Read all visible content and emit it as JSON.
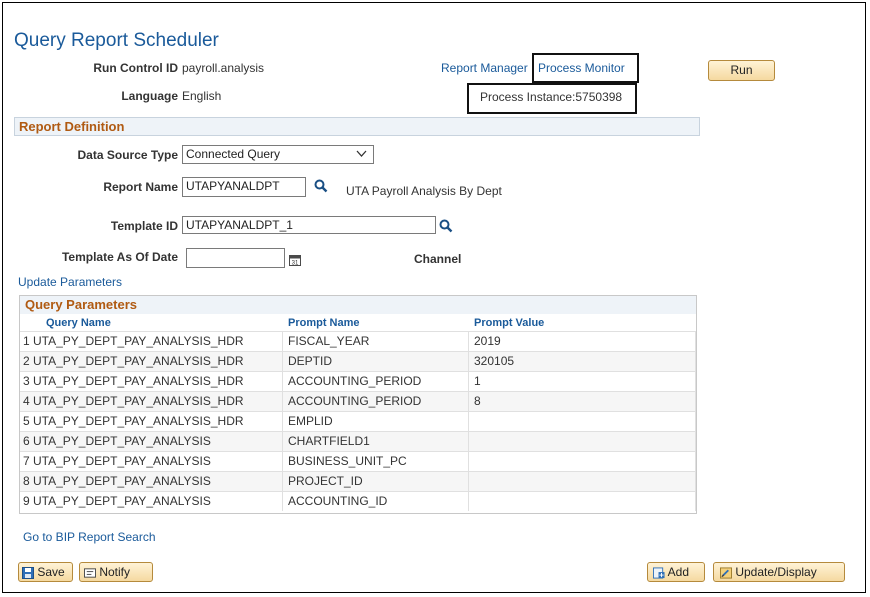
{
  "page": {
    "title": "Query Report Scheduler",
    "run_control_label": "Run Control ID",
    "run_control_value": "payroll.analysis",
    "language_label": "Language",
    "language_value": "English",
    "report_manager_link": "Report Manager",
    "process_monitor_link": "Process Monitor",
    "process_instance": "Process Instance:5750398",
    "run_button": "Run"
  },
  "report_definition": {
    "header": "Report Definition",
    "data_source_label": "Data Source Type",
    "data_source_value": "Connected Query",
    "report_name_label": "Report Name",
    "report_name_value": "UTAPYANALDPT",
    "report_description": "UTA Payroll Analysis By Dept",
    "template_id_label": "Template ID",
    "template_id_value": "UTAPYANALDPT_1",
    "template_date_label": "Template As Of Date",
    "template_date_value": "",
    "channel_label": "Channel",
    "update_parameters_link": "Update Parameters"
  },
  "query_parameters": {
    "header": "Query Parameters",
    "columns": [
      "Query Name",
      "Prompt Name",
      "Prompt Value"
    ],
    "rows": [
      {
        "num": "1",
        "query": "UTA_PY_DEPT_PAY_ANALYSIS_HDR",
        "prompt": "FISCAL_YEAR",
        "value": "2019"
      },
      {
        "num": "2",
        "query": "UTA_PY_DEPT_PAY_ANALYSIS_HDR",
        "prompt": "DEPTID",
        "value": "320105"
      },
      {
        "num": "3",
        "query": "UTA_PY_DEPT_PAY_ANALYSIS_HDR",
        "prompt": "ACCOUNTING_PERIOD",
        "value": "1"
      },
      {
        "num": "4",
        "query": "UTA_PY_DEPT_PAY_ANALYSIS_HDR",
        "prompt": "ACCOUNTING_PERIOD",
        "value": "8"
      },
      {
        "num": "5",
        "query": "UTA_PY_DEPT_PAY_ANALYSIS_HDR",
        "prompt": "EMPLID",
        "value": ""
      },
      {
        "num": "6",
        "query": "UTA_PY_DEPT_PAY_ANALYSIS",
        "prompt": "CHARTFIELD1",
        "value": ""
      },
      {
        "num": "7",
        "query": "UTA_PY_DEPT_PAY_ANALYSIS",
        "prompt": "BUSINESS_UNIT_PC",
        "value": ""
      },
      {
        "num": "8",
        "query": "UTA_PY_DEPT_PAY_ANALYSIS",
        "prompt": "PROJECT_ID",
        "value": ""
      },
      {
        "num": "9",
        "query": "UTA_PY_DEPT_PAY_ANALYSIS",
        "prompt": "ACCOUNTING_ID",
        "value": ""
      }
    ]
  },
  "footer": {
    "bip_link": "Go to BIP Report Search",
    "save_button": "Save",
    "notify_button": "Notify",
    "add_button": "Add",
    "update_display_button": "Update/Display"
  }
}
